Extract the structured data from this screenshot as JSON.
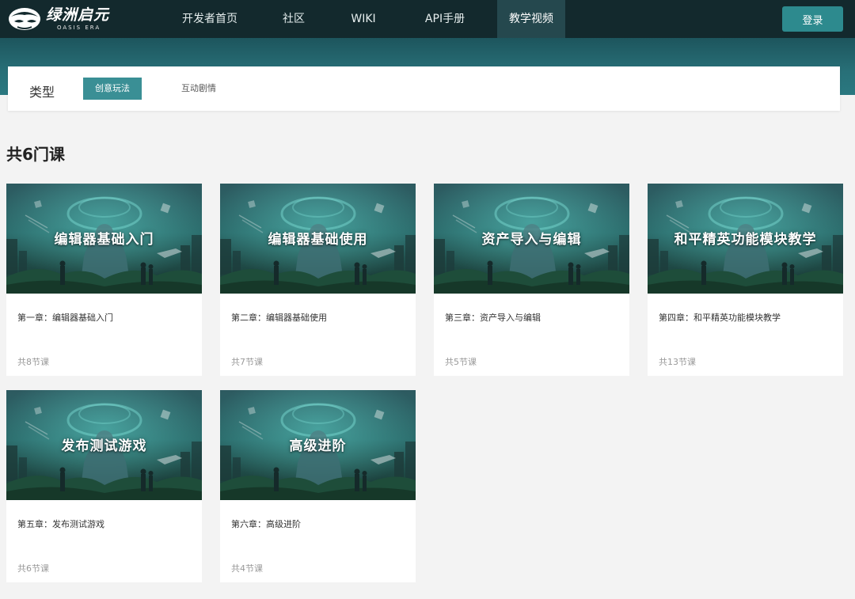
{
  "brand": {
    "name_cn": "绿洲启元",
    "name_en": "OASIS ERA"
  },
  "nav": {
    "items": [
      {
        "label": "开发者首页"
      },
      {
        "label": "社区"
      },
      {
        "label": "WIKI"
      },
      {
        "label": "API手册"
      },
      {
        "label": "教学视频",
        "active": true
      }
    ],
    "login_label": "登录"
  },
  "filter": {
    "label": "类型",
    "options": [
      {
        "label": "创意玩法",
        "active": true
      },
      {
        "label": "互动剧情",
        "active": false
      }
    ]
  },
  "course_count_label": "共6门课",
  "courses": [
    {
      "thumb_title": "编辑器基础入门",
      "chapter": "第一章：编辑器基础入门",
      "lessons": "共8节课"
    },
    {
      "thumb_title": "编辑器基础使用",
      "chapter": "第二章：编辑器基础使用",
      "lessons": "共7节课"
    },
    {
      "thumb_title": "资产导入与编辑",
      "chapter": "第三章：资产导入与编辑",
      "lessons": "共5节课"
    },
    {
      "thumb_title": "和平精英功能模块教学",
      "chapter": "第四章：和平精英功能模块教学",
      "lessons": "共13节课"
    },
    {
      "thumb_title": "发布测试游戏",
      "chapter": "第五章：发布测试游戏",
      "lessons": "共6节课"
    },
    {
      "thumb_title": "高级进阶",
      "chapter": "第六章：高级进阶",
      "lessons": "共4节课"
    }
  ],
  "colors": {
    "topbar": "#13292d",
    "accent": "#2d8a8e",
    "chip_active": "#3a8f95",
    "page_bg": "#f3f3f3"
  }
}
